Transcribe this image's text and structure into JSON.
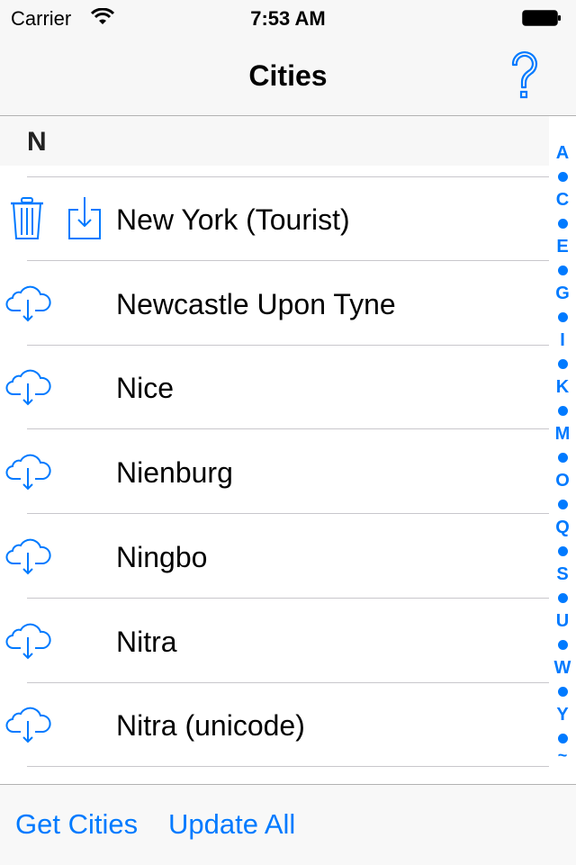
{
  "status_bar": {
    "carrier": "Carrier",
    "time": "7:53 AM",
    "icons": [
      "wifi-icon",
      "battery-icon"
    ]
  },
  "nav": {
    "title": "Cities",
    "help_icon": "question-mark-icon"
  },
  "section": {
    "header": "N"
  },
  "rows": [
    {
      "name": "New York (Tourist)",
      "state": "downloaded",
      "icons": [
        "trash-icon",
        "save-to-device-icon"
      ]
    },
    {
      "name": "Newcastle Upon Tyne",
      "state": "cloud",
      "icons": [
        "cloud-download-icon"
      ]
    },
    {
      "name": "Nice",
      "state": "cloud",
      "icons": [
        "cloud-download-icon"
      ]
    },
    {
      "name": "Nienburg",
      "state": "cloud",
      "icons": [
        "cloud-download-icon"
      ]
    },
    {
      "name": "Ningbo",
      "state": "cloud",
      "icons": [
        "cloud-download-icon"
      ]
    },
    {
      "name": "Nitra",
      "state": "cloud",
      "icons": [
        "cloud-download-icon"
      ]
    },
    {
      "name": "Nitra (unicode)",
      "state": "cloud",
      "icons": [
        "cloud-download-icon"
      ]
    }
  ],
  "index": [
    "A",
    "•",
    "C",
    "•",
    "E",
    "•",
    "G",
    "•",
    "I",
    "•",
    "K",
    "•",
    "M",
    "•",
    "O",
    "•",
    "Q",
    "•",
    "S",
    "•",
    "U",
    "•",
    "W",
    "•",
    "Y",
    "•",
    "~"
  ],
  "toolbar": {
    "get_cities": "Get Cities",
    "update_all": "Update All"
  },
  "colors": {
    "accent": "#007aff",
    "bar_background": "#f7f7f7",
    "separator": "#c8c7cc"
  }
}
